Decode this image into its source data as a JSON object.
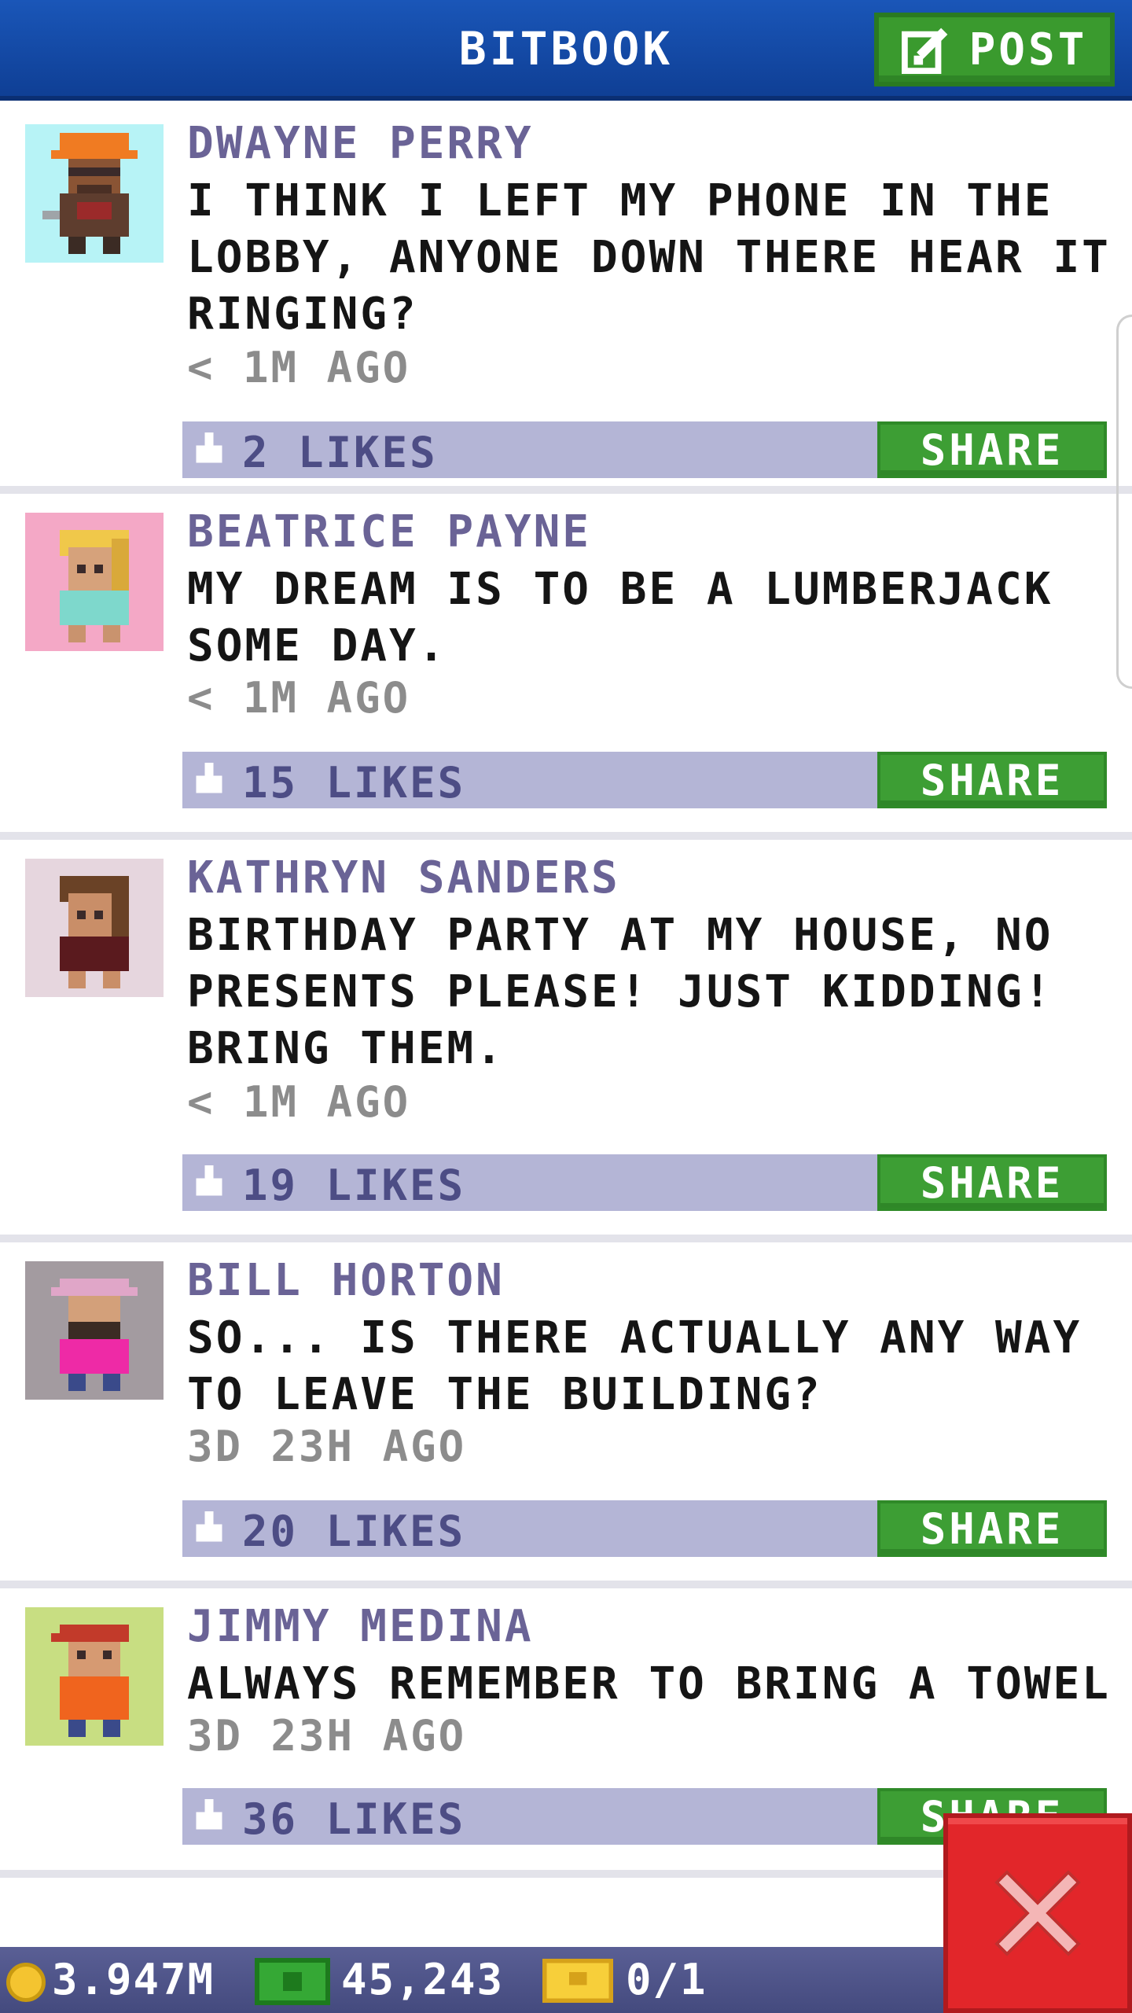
{
  "header": {
    "title": "BITBOOK",
    "post_label": "POST"
  },
  "posts": [
    {
      "author": "DWAYNE PERRY",
      "message": "I THINK I LEFT MY PHONE IN THE LOBBY, ANYONE DOWN THERE HEAR IT RINGING?",
      "time": "< 1M AGO",
      "likes": "2 LIKES",
      "share": "SHARE",
      "avatar": "construction-worker-avatar"
    },
    {
      "author": "BEATRICE PAYNE",
      "message": "MY DREAM IS TO BE A LUMBERJACK SOME DAY.",
      "time": "< 1M AGO",
      "likes": "15 LIKES",
      "share": "SHARE",
      "avatar": "blonde-woman-avatar"
    },
    {
      "author": "KATHRYN SANDERS",
      "message": "BIRTHDAY PARTY AT MY HOUSE, NO PRESENTS PLEASE! JUST KIDDING! BRING THEM.",
      "time": "< 1M AGO",
      "likes": "19 LIKES",
      "share": "SHARE",
      "avatar": "brown-haired-woman-avatar"
    },
    {
      "author": "BILL HORTON",
      "message": "SO... IS THERE ACTUALLY ANY WAY TO LEAVE THE BUILDING?",
      "time": "3D 23H AGO",
      "likes": "20 LIKES",
      "share": "SHARE",
      "avatar": "bearded-man-avatar"
    },
    {
      "author": "JIMMY MEDINA",
      "message": "ALWAYS REMEMBER TO BRING A TOWEL",
      "time": "3D 23H AGO",
      "likes": "36 LIKES",
      "share": "SHARE",
      "avatar": "red-cap-man-avatar"
    }
  ],
  "footer": {
    "coins": "3.947M",
    "bux": "45,243",
    "tickets": "0/1"
  },
  "colors": {
    "header": "#1a56b8",
    "author": "#6a6396",
    "like_bar": "#b4b5d6",
    "share_button": "#3d9e34",
    "close_button": "#e2262a"
  }
}
